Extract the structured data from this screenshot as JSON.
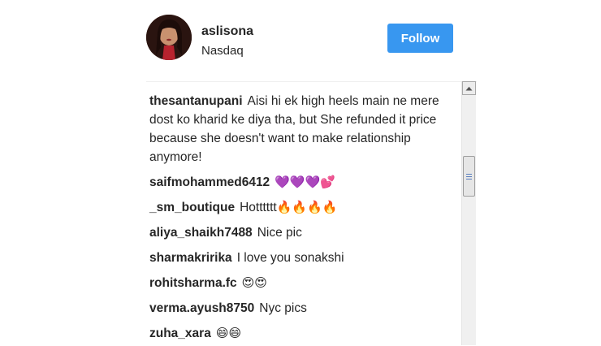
{
  "header": {
    "username": "aslisona",
    "location": "Nasdaq",
    "follow_label": "Follow"
  },
  "colors": {
    "accent": "#3897f0",
    "text": "#262626"
  },
  "comments": [
    {
      "user": "thesantanupani",
      "text": "Aisi hi ek high heels main ne mere dost ko kharid ke diya tha, but She refunded it price because she doesn't want to make relationship anymore!"
    },
    {
      "user": "saifmohammed6412",
      "text": "",
      "emoji": "💜💜💜💕"
    },
    {
      "user": "_sm_boutique",
      "text": "Hotttttt",
      "emoji": "🔥🔥🔥🔥"
    },
    {
      "user": "aliya_shaikh7488",
      "text": "Nice pic"
    },
    {
      "user": "sharmakririka",
      "text": "I love you sonakshi"
    },
    {
      "user": "rohitsharma.fc",
      "text": "",
      "emoji": "😍😍"
    },
    {
      "user": "verma.ayush8750",
      "text": "Nyc pics"
    },
    {
      "user": "zuha_xara",
      "text": "",
      "emoji": "😄😄"
    }
  ]
}
